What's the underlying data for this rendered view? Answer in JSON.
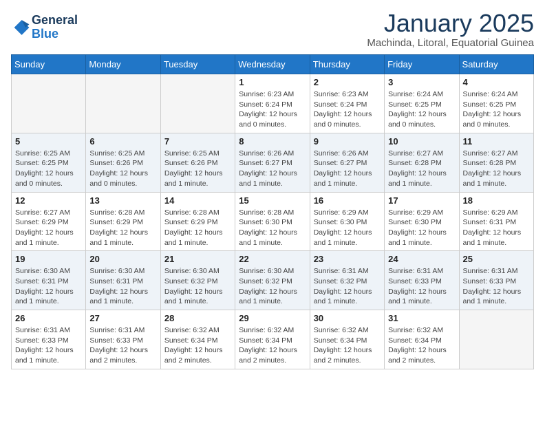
{
  "logo": {
    "line1": "General",
    "line2": "Blue"
  },
  "title": "January 2025",
  "location": "Machinda, Litoral, Equatorial Guinea",
  "weekdays": [
    "Sunday",
    "Monday",
    "Tuesday",
    "Wednesday",
    "Thursday",
    "Friday",
    "Saturday"
  ],
  "weeks": [
    [
      {
        "day": "",
        "sunrise": "",
        "sunset": "",
        "daylight": ""
      },
      {
        "day": "",
        "sunrise": "",
        "sunset": "",
        "daylight": ""
      },
      {
        "day": "",
        "sunrise": "",
        "sunset": "",
        "daylight": ""
      },
      {
        "day": "1",
        "sunrise": "Sunrise: 6:23 AM",
        "sunset": "Sunset: 6:24 PM",
        "daylight": "Daylight: 12 hours and 0 minutes."
      },
      {
        "day": "2",
        "sunrise": "Sunrise: 6:23 AM",
        "sunset": "Sunset: 6:24 PM",
        "daylight": "Daylight: 12 hours and 0 minutes."
      },
      {
        "day": "3",
        "sunrise": "Sunrise: 6:24 AM",
        "sunset": "Sunset: 6:25 PM",
        "daylight": "Daylight: 12 hours and 0 minutes."
      },
      {
        "day": "4",
        "sunrise": "Sunrise: 6:24 AM",
        "sunset": "Sunset: 6:25 PM",
        "daylight": "Daylight: 12 hours and 0 minutes."
      }
    ],
    [
      {
        "day": "5",
        "sunrise": "Sunrise: 6:25 AM",
        "sunset": "Sunset: 6:25 PM",
        "daylight": "Daylight: 12 hours and 0 minutes."
      },
      {
        "day": "6",
        "sunrise": "Sunrise: 6:25 AM",
        "sunset": "Sunset: 6:26 PM",
        "daylight": "Daylight: 12 hours and 0 minutes."
      },
      {
        "day": "7",
        "sunrise": "Sunrise: 6:25 AM",
        "sunset": "Sunset: 6:26 PM",
        "daylight": "Daylight: 12 hours and 1 minute."
      },
      {
        "day": "8",
        "sunrise": "Sunrise: 6:26 AM",
        "sunset": "Sunset: 6:27 PM",
        "daylight": "Daylight: 12 hours and 1 minute."
      },
      {
        "day": "9",
        "sunrise": "Sunrise: 6:26 AM",
        "sunset": "Sunset: 6:27 PM",
        "daylight": "Daylight: 12 hours and 1 minute."
      },
      {
        "day": "10",
        "sunrise": "Sunrise: 6:27 AM",
        "sunset": "Sunset: 6:28 PM",
        "daylight": "Daylight: 12 hours and 1 minute."
      },
      {
        "day": "11",
        "sunrise": "Sunrise: 6:27 AM",
        "sunset": "Sunset: 6:28 PM",
        "daylight": "Daylight: 12 hours and 1 minute."
      }
    ],
    [
      {
        "day": "12",
        "sunrise": "Sunrise: 6:27 AM",
        "sunset": "Sunset: 6:29 PM",
        "daylight": "Daylight: 12 hours and 1 minute."
      },
      {
        "day": "13",
        "sunrise": "Sunrise: 6:28 AM",
        "sunset": "Sunset: 6:29 PM",
        "daylight": "Daylight: 12 hours and 1 minute."
      },
      {
        "day": "14",
        "sunrise": "Sunrise: 6:28 AM",
        "sunset": "Sunset: 6:29 PM",
        "daylight": "Daylight: 12 hours and 1 minute."
      },
      {
        "day": "15",
        "sunrise": "Sunrise: 6:28 AM",
        "sunset": "Sunset: 6:30 PM",
        "daylight": "Daylight: 12 hours and 1 minute."
      },
      {
        "day": "16",
        "sunrise": "Sunrise: 6:29 AM",
        "sunset": "Sunset: 6:30 PM",
        "daylight": "Daylight: 12 hours and 1 minute."
      },
      {
        "day": "17",
        "sunrise": "Sunrise: 6:29 AM",
        "sunset": "Sunset: 6:30 PM",
        "daylight": "Daylight: 12 hours and 1 minute."
      },
      {
        "day": "18",
        "sunrise": "Sunrise: 6:29 AM",
        "sunset": "Sunset: 6:31 PM",
        "daylight": "Daylight: 12 hours and 1 minute."
      }
    ],
    [
      {
        "day": "19",
        "sunrise": "Sunrise: 6:30 AM",
        "sunset": "Sunset: 6:31 PM",
        "daylight": "Daylight: 12 hours and 1 minute."
      },
      {
        "day": "20",
        "sunrise": "Sunrise: 6:30 AM",
        "sunset": "Sunset: 6:31 PM",
        "daylight": "Daylight: 12 hours and 1 minute."
      },
      {
        "day": "21",
        "sunrise": "Sunrise: 6:30 AM",
        "sunset": "Sunset: 6:32 PM",
        "daylight": "Daylight: 12 hours and 1 minute."
      },
      {
        "day": "22",
        "sunrise": "Sunrise: 6:30 AM",
        "sunset": "Sunset: 6:32 PM",
        "daylight": "Daylight: 12 hours and 1 minute."
      },
      {
        "day": "23",
        "sunrise": "Sunrise: 6:31 AM",
        "sunset": "Sunset: 6:32 PM",
        "daylight": "Daylight: 12 hours and 1 minute."
      },
      {
        "day": "24",
        "sunrise": "Sunrise: 6:31 AM",
        "sunset": "Sunset: 6:33 PM",
        "daylight": "Daylight: 12 hours and 1 minute."
      },
      {
        "day": "25",
        "sunrise": "Sunrise: 6:31 AM",
        "sunset": "Sunset: 6:33 PM",
        "daylight": "Daylight: 12 hours and 1 minute."
      }
    ],
    [
      {
        "day": "26",
        "sunrise": "Sunrise: 6:31 AM",
        "sunset": "Sunset: 6:33 PM",
        "daylight": "Daylight: 12 hours and 1 minute."
      },
      {
        "day": "27",
        "sunrise": "Sunrise: 6:31 AM",
        "sunset": "Sunset: 6:33 PM",
        "daylight": "Daylight: 12 hours and 2 minutes."
      },
      {
        "day": "28",
        "sunrise": "Sunrise: 6:32 AM",
        "sunset": "Sunset: 6:34 PM",
        "daylight": "Daylight: 12 hours and 2 minutes."
      },
      {
        "day": "29",
        "sunrise": "Sunrise: 6:32 AM",
        "sunset": "Sunset: 6:34 PM",
        "daylight": "Daylight: 12 hours and 2 minutes."
      },
      {
        "day": "30",
        "sunrise": "Sunrise: 6:32 AM",
        "sunset": "Sunset: 6:34 PM",
        "daylight": "Daylight: 12 hours and 2 minutes."
      },
      {
        "day": "31",
        "sunrise": "Sunrise: 6:32 AM",
        "sunset": "Sunset: 6:34 PM",
        "daylight": "Daylight: 12 hours and 2 minutes."
      },
      {
        "day": "",
        "sunrise": "",
        "sunset": "",
        "daylight": ""
      }
    ]
  ]
}
